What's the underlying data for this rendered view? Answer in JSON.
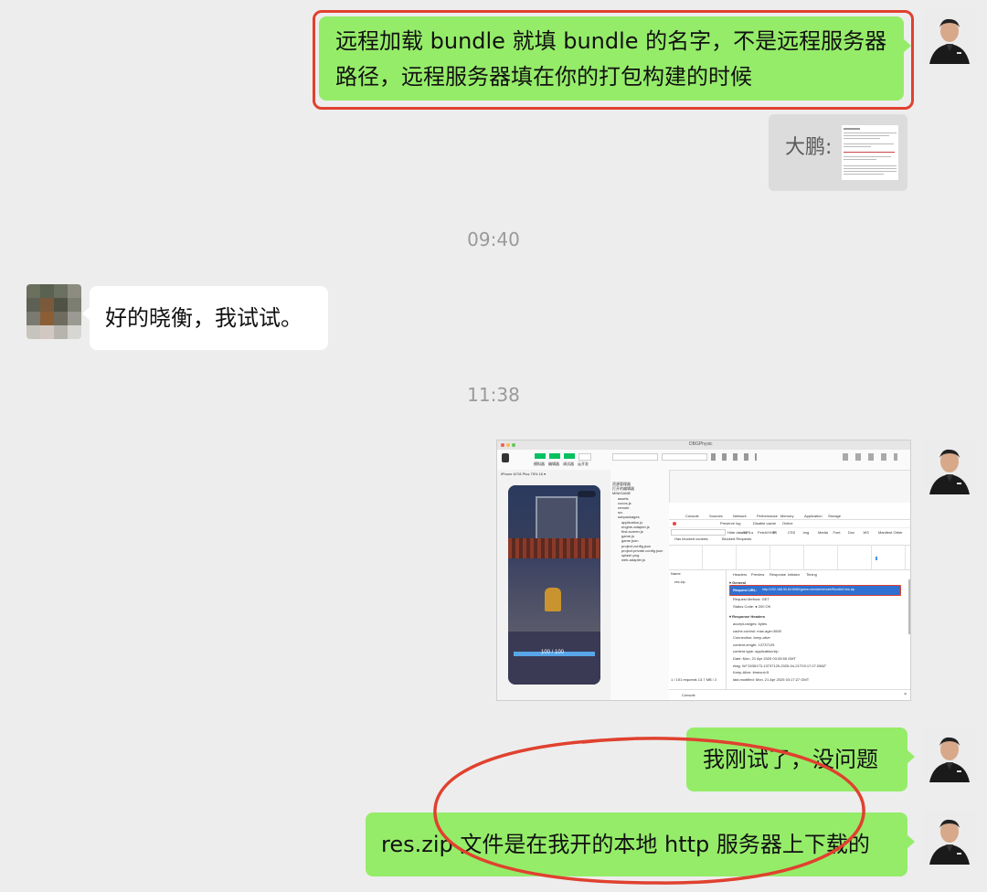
{
  "messages": {
    "m1_text": "远程加载 bundle 就填 bundle 的名字，不是远程服务器路径，远程服务器填在你的打包构建的时候",
    "m1_line1": "远程加载 bundle 就填 bundle 的名字，不是远程服务器",
    "m1_line2": "路径，远程服务器填在你的打包构建的时候",
    "quote_sender": "大鹏:",
    "time1": "09:40",
    "m2_text": "好的晓衡，我试试。",
    "time2": "11:38",
    "m3_text": "我刚试了，没问题",
    "m4_text": "res.zip 文件是在我开的本地 http 服务器上下载的"
  },
  "screenshot": {
    "window_title": "DBGPhysic",
    "device": "iPhone 6/7/8 Plus 75% 16 ▾",
    "hp_text": "100 / 100",
    "toolbar_buttons": [
      "模拟器",
      "编辑器",
      "调试器",
      "云开发"
    ],
    "file_tree": [
      "资源管理器",
      "打开的编辑器",
      "MINIGAME",
      "assets",
      "cocos-js",
      "remote",
      "src",
      "subpackages",
      "application.js",
      "engine-adapter.js",
      "first-screen.js",
      "game.js",
      "game.json",
      "project.config.json",
      "project.private.config.json",
      "splash.png",
      "web-adapter.js"
    ],
    "devtools_tabs": [
      "Console",
      "Sources",
      "Network",
      "Performance",
      "Memory",
      "Application",
      "Storage"
    ],
    "filter_types": [
      "Hide data URLs",
      "All",
      "Fetch/XHR",
      "JS",
      "CSS",
      "Img",
      "Media",
      "Font",
      "Doc",
      "WS",
      "Manifest",
      "Other"
    ],
    "detail_tabs": [
      "Headers",
      "Preview",
      "Response",
      "Initiator",
      "Timing"
    ],
    "request_name": "res.zip",
    "general_label": "▾ General",
    "request_url_label": "Request URL:",
    "request_url": "http://192.168.50.84:8080/game-remote/remote/Bundle1/res.zip",
    "request_method": "Request Method: GET",
    "status_code": "Status Code: ● 200 OK",
    "response_headers_label": "▾ Response Headers",
    "headers": [
      "accept-ranges: bytes",
      "cache-control: max-age=3600",
      "Connection: keep-alive",
      "content-length: 13737125",
      "content-type: application/zip",
      "Date: Mon, 21 Apr 2025 03:33:55 GMT",
      "etag: W/\"1535173-13737125-2025-04-21T03:17:27.058Z\"",
      "Keep-Alive: timeout=5",
      "last-modified: Mon, 21 Apr 2025 03:17:27 GMT"
    ],
    "status_bar": "1 / 151 requests   13.7 MB / 2",
    "console_tab": "Console",
    "name_col": "Name",
    "preserve_log": "Preserve log",
    "disable_cache": "Disable cache",
    "online": "Online",
    "blocked_cookies": "Has blocked cookies",
    "blocked_requests": "Blocked Requests"
  },
  "colors": {
    "bubble_green": "#95ec69",
    "bubble_white": "#ffffff",
    "background": "#ededed",
    "annotation_red": "#e0412f"
  }
}
